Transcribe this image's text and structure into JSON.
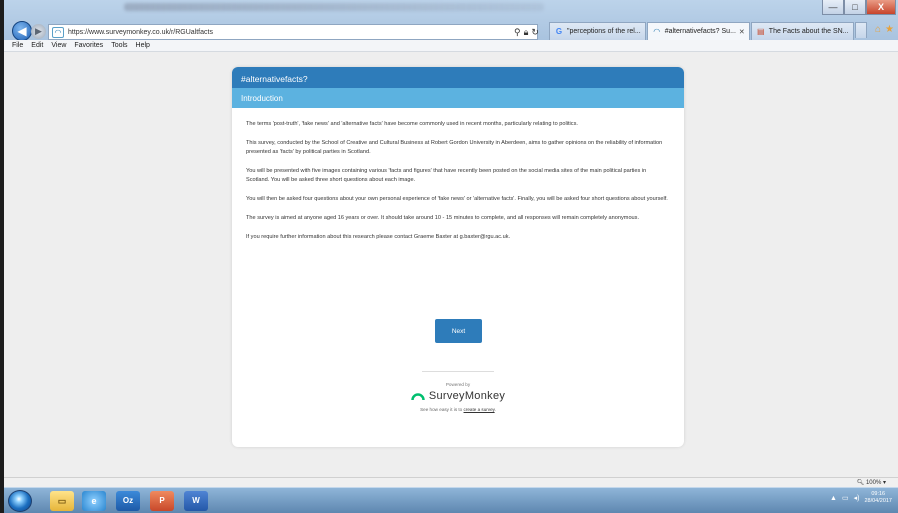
{
  "browser": {
    "url": "https://www.surveymonkey.co.uk/r/RGUaltfacts",
    "tabs": [
      {
        "label": "\"perceptions of the rel...",
        "icon": "G",
        "active": false
      },
      {
        "label": "#alternativefacts? Su...",
        "icon": "◠",
        "active": true
      },
      {
        "label": "The Facts about the SN...",
        "icon": "▤",
        "active": false
      }
    ],
    "window_controls": {
      "minimize": "—",
      "maximize": "□",
      "close": "X"
    },
    "menu": [
      "File",
      "Edit",
      "View",
      "Favorites",
      "Tools",
      "Help"
    ],
    "zoom": "100%"
  },
  "survey": {
    "title": "#alternativefacts?",
    "page_header": "Introduction",
    "paragraphs": [
      "The terms 'post-truth', 'fake news' and 'alternative facts' have become commonly used in recent months, particularly relating to politics.",
      "This survey, conducted by the School of Creative and Cultural Business at Robert Gordon University in Aberdeen, aims to gather opinions on the reliability of information presented as 'facts' by political parties in Scotland.",
      "You will be presented with five images containing various 'facts and figures' that have recently been posted on the social media sites of the main political parties in Scotland. You will be asked three short questions about each image.",
      "You will then be asked four questions about your own personal experience of 'fake news' or 'alternative facts'. Finally, you will be asked four short questions about yourself.",
      "The survey is aimed at anyone aged 16 years or over. It should take around 10 - 15 minutes to complete, and all responses will remain completely anonymous.",
      "If you require further information about this research please contact Graeme Baxter at g.baxter@rgu.ac.uk."
    ],
    "next_label": "Next",
    "powered_by": "Powered by",
    "brand": "SurveyMonkey",
    "tagline_prefix": "See how easy it is to ",
    "tagline_link": "create a survey",
    "tagline_suffix": "."
  },
  "taskbar": {
    "apps": [
      {
        "name": "explorer",
        "glyph": "▭"
      },
      {
        "name": "internet-explorer",
        "glyph": "e"
      },
      {
        "name": "outlook",
        "glyph": "Oz"
      },
      {
        "name": "powerpoint",
        "glyph": "P"
      },
      {
        "name": "word",
        "glyph": "W"
      }
    ],
    "time": "09:16",
    "date": "28/04/2017"
  },
  "colors": {
    "survey_title_bg": "#2e7cba",
    "page_header_bg": "#5cb2e0",
    "next_button_bg": "#2e7cba"
  }
}
